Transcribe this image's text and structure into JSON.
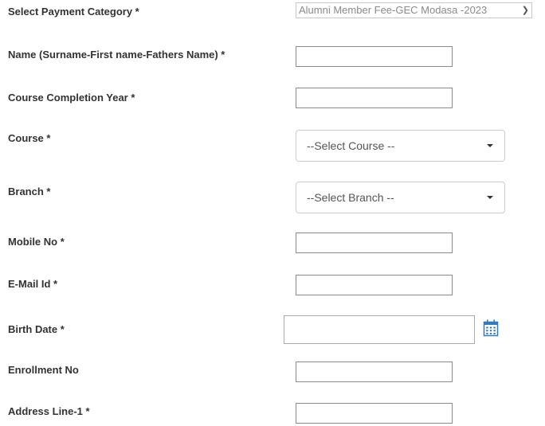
{
  "form": {
    "payment_category": {
      "label": "Select Payment Category *",
      "selected": "Alumni Member Fee-GEC Modasa -2023"
    },
    "name": {
      "label": "Name (Surname-First name-Fathers Name) *",
      "value": ""
    },
    "completion_year": {
      "label": "Course Completion Year *",
      "value": ""
    },
    "course": {
      "label": "Course *",
      "selected": "--Select Course --"
    },
    "branch": {
      "label": "Branch *",
      "selected": "--Select Branch --"
    },
    "mobile": {
      "label": "Mobile No *",
      "value": ""
    },
    "email": {
      "label": "E-Mail Id *",
      "value": ""
    },
    "birth_date": {
      "label": "Birth Date *",
      "value": ""
    },
    "enrollment": {
      "label": "Enrollment No",
      "value": ""
    },
    "address1": {
      "label": "Address Line-1 *",
      "value": ""
    }
  },
  "icons": {
    "calendar": "calendar-icon",
    "chevron": "chevron-down-icon",
    "caret": "caret-down-icon"
  },
  "colors": {
    "label_text": "#333333",
    "calendar_icon": "#337ab7",
    "disabled_text": "#8a8a8a"
  }
}
